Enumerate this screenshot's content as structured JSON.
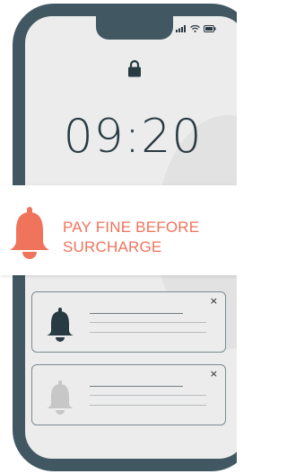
{
  "status_bar": {
    "icons": [
      "signal-icon",
      "wifi-icon",
      "battery-icon"
    ]
  },
  "lock_screen": {
    "lock_icon": "lock-icon",
    "time": "09:20"
  },
  "banner": {
    "icon": "bell-icon",
    "message": "PAY FINE BEFORE SURCHARGE",
    "accent_color": "#f0735b"
  },
  "notifications": [
    {
      "icon": "bell-icon",
      "close_label": "×",
      "state": "active"
    },
    {
      "icon": "bell-icon",
      "close_label": "×",
      "state": "muted"
    }
  ],
  "colors": {
    "phone_frame": "#415862",
    "screen": "#ececec",
    "clock": "#283a42",
    "bell_muted": "#c7c7c7"
  }
}
